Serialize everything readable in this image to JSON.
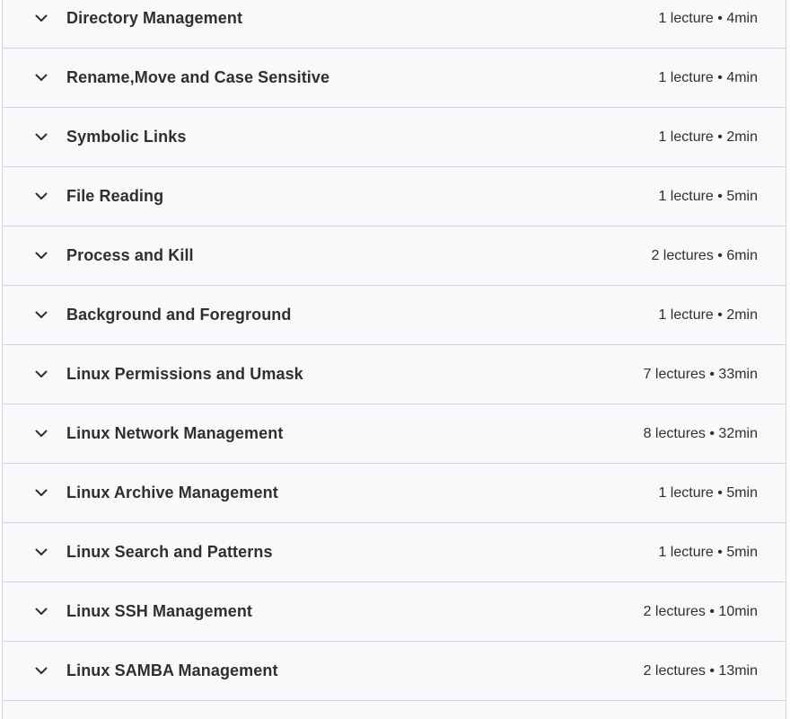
{
  "curriculum": {
    "sections": [
      {
        "title": "Directory Management",
        "meta": "1 lecture • 4min"
      },
      {
        "title": "Rename,Move and Case Sensitive",
        "meta": "1 lecture • 4min"
      },
      {
        "title": "Symbolic Links",
        "meta": "1 lecture • 2min"
      },
      {
        "title": "File Reading",
        "meta": "1 lecture • 5min"
      },
      {
        "title": "Process and Kill",
        "meta": "2 lectures • 6min"
      },
      {
        "title": "Background and Foreground",
        "meta": "1 lecture • 2min"
      },
      {
        "title": "Linux Permissions and Umask",
        "meta": "7 lectures • 33min"
      },
      {
        "title": "Linux Network Management",
        "meta": "8 lectures • 32min"
      },
      {
        "title": "Linux Archive Management",
        "meta": "1 lecture • 5min"
      },
      {
        "title": "Linux Search and Patterns",
        "meta": "1 lecture • 5min"
      },
      {
        "title": "Linux SSH Management",
        "meta": "2 lectures • 10min"
      },
      {
        "title": "Linux SAMBA Management",
        "meta": "2 lectures • 13min"
      }
    ],
    "icon": "chevron-down-icon",
    "colors": {
      "row_background": "#f7f9fa",
      "border": "#d1d7dc",
      "text": "#2d2f31"
    }
  }
}
